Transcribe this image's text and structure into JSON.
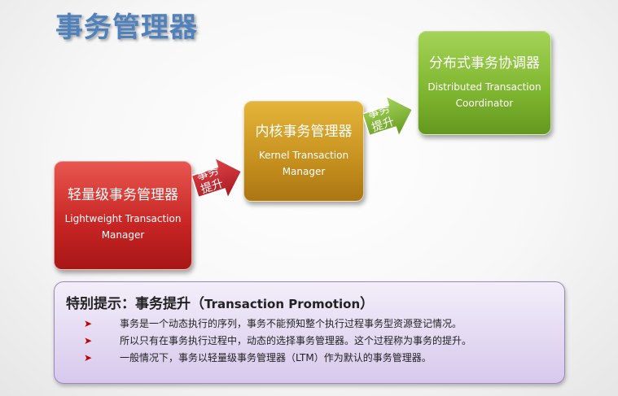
{
  "title": "事务管理器",
  "boxes": {
    "ltm": {
      "zh": "轻量级事务管理器",
      "en": "Lightweight Transaction Manager"
    },
    "ktm": {
      "zh": "内核事务管理器",
      "en": "Kernel Transaction Manager"
    },
    "dtc": {
      "zh": "分布式事务协调器",
      "en": "Distributed Transaction Coordinator"
    }
  },
  "arrows": {
    "first": {
      "line1": "事务",
      "line2": "提升"
    },
    "second": {
      "line1": "事务",
      "line2": "提升"
    }
  },
  "note": {
    "title_zh": "特别提示：事务提升（",
    "title_en": "Transaction Promotion",
    "title_close": "）",
    "bullets": [
      "事务是一个动态执行的序列，事务不能预知整个执行过程事务型资源登记情况。",
      "所以只有在事务执行过程中，动态的选择事务管理器。这个过程称为事务的提升。",
      "一般情况下，事务以轻量级事务管理器（LTM）作为默认的事务管理器。"
    ]
  },
  "colors": {
    "title": "#4f81bd",
    "ltm": "#c62423",
    "ktm": "#c6901e",
    "dtc": "#7eb52f",
    "arrow1": "#c0202a",
    "arrow2": "#7eb52f",
    "bullet": "#c00000"
  },
  "icons": {
    "bullet": "arrow-bullet-icon",
    "promotion": "right-arrow-icon"
  }
}
